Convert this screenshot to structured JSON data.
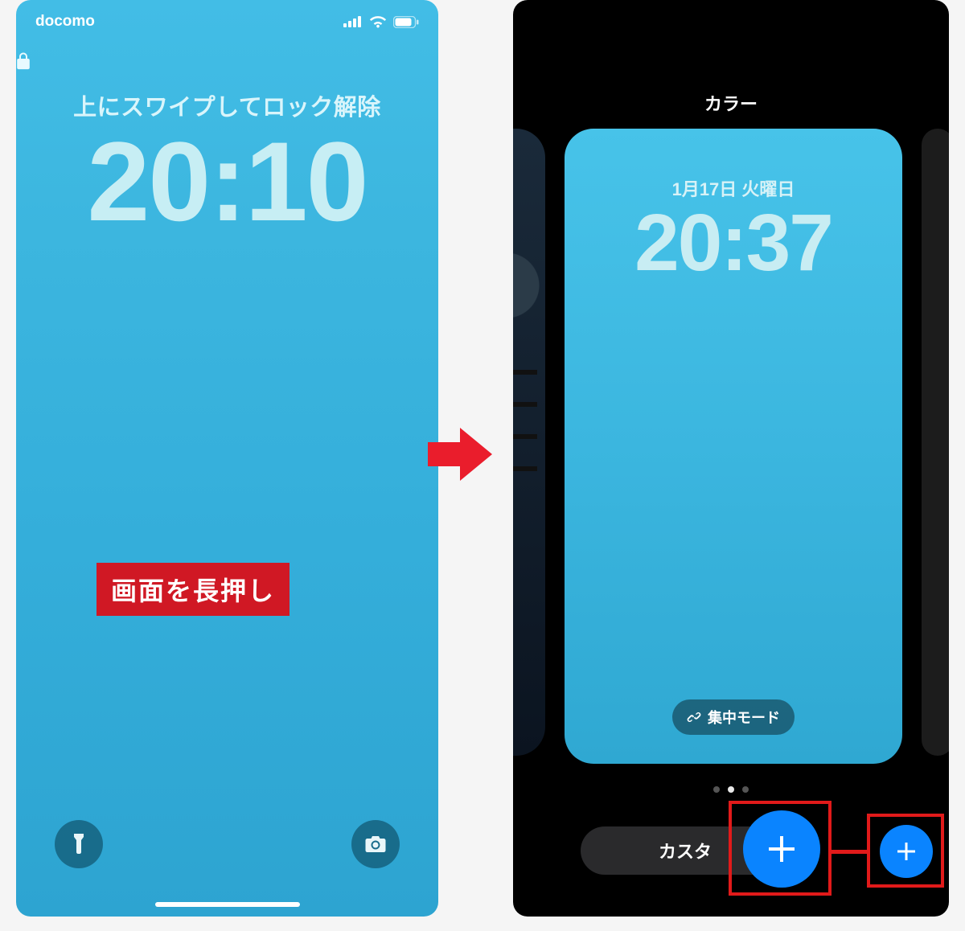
{
  "left": {
    "carrier": "docomo",
    "swipe_hint": "上にスワイプしてロック解除",
    "time": "20:10",
    "callout": "画面を長押し"
  },
  "right": {
    "gallery_title": "カラー",
    "preview_date": "1月17日 火曜日",
    "preview_time": "20:37",
    "focus_label": "集中モード",
    "customize_label": "カスタ"
  },
  "icons": {
    "lock": "lock-icon",
    "flashlight": "flashlight-icon",
    "camera": "camera-icon",
    "link": "link-icon",
    "plus": "plus-icon",
    "signal": "signal-icon",
    "wifi": "wifi-icon",
    "battery": "battery-icon"
  },
  "colors": {
    "accent_blue": "#0a84ff",
    "callout_red": "#d01824",
    "highlight_red": "#e11a1a"
  }
}
